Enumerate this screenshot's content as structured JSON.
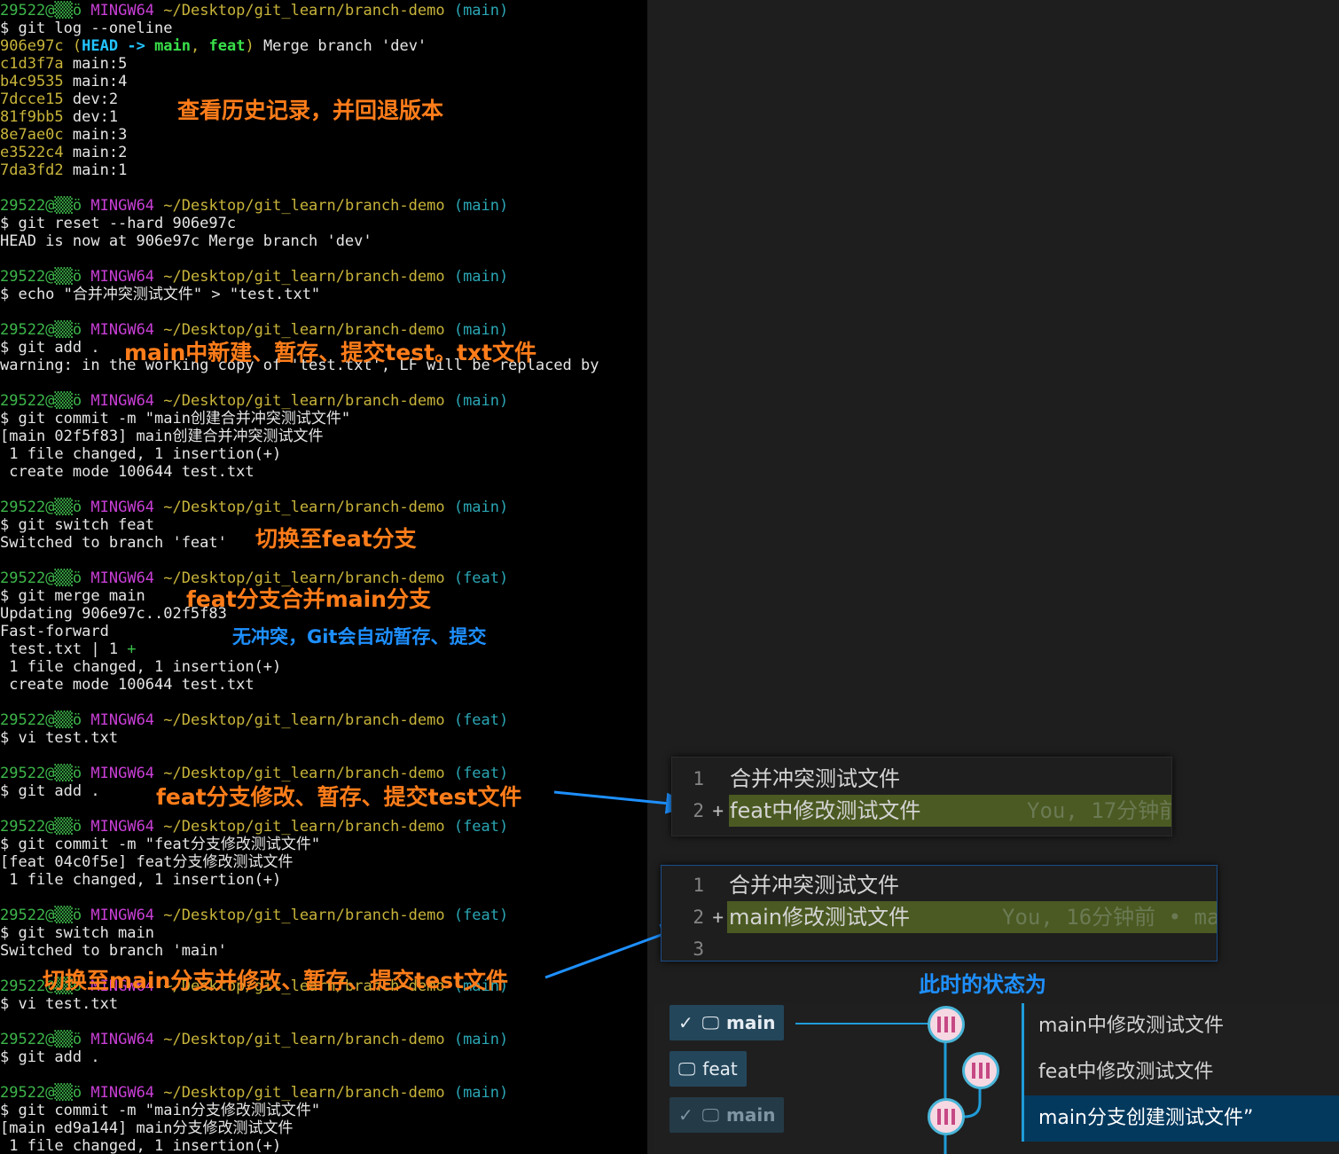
{
  "terminal": {
    "prompt": {
      "user": "29522@",
      "host_glyph": "▒▒ö",
      "env": "MINGW64",
      "path": "~/Desktop/git_learn/branch-demo",
      "branch_main": "(main)",
      "branch_feat": "(feat)"
    },
    "log": {
      "cmd": "$ git log --oneline",
      "head_hash": "906e97c",
      "head_open": "(",
      "head_label": "HEAD",
      "head_arrow": " -> ",
      "head_main": "main",
      "head_sep": ", ",
      "head_feat": "feat",
      "head_close": ")",
      "head_msg": " Merge branch 'dev'",
      "entries": [
        {
          "hash": "c1d3f7a",
          "msg": " main:5"
        },
        {
          "hash": "b4c9535",
          "msg": " main:4"
        },
        {
          "hash": "7dcce15",
          "msg": " dev:2"
        },
        {
          "hash": "81f9bb5",
          "msg": " dev:1"
        },
        {
          "hash": "8e7ae0c",
          "msg": " main:3"
        },
        {
          "hash": "e3522c4",
          "msg": " main:2"
        },
        {
          "hash": "7da3fd2",
          "msg": " main:1"
        }
      ]
    },
    "lines": {
      "reset_cmd": "$ git reset --hard 906e97c",
      "reset_out": "HEAD is now at 906e97c Merge branch 'dev'",
      "echo_cmd": "$ echo \"合并冲突测试文件\" > \"test.txt\"",
      "add_cmd": "$ git add .",
      "warning": "warning: in the working copy of 'test.txt', LF will be replaced by",
      "commit1_cmd": "$ git commit -m \"main创建合并冲突测试文件\"",
      "commit1_out": "[main 02f5f83] main创建合并冲突测试文件",
      "changed": " 1 file changed, 1 insertion(+)",
      "create_mode": " create mode 100644 test.txt",
      "switch_feat_cmd": "$ git switch feat",
      "switch_feat_out": "Switched to branch 'feat'",
      "merge_cmd": "$ git merge main",
      "merge_out": "Updating 906e97c..02f5f83",
      "ff": "Fast-forward",
      "stat": " test.txt | 1 ",
      "stat_plus": "+",
      "vi_cmd": "$ vi test.txt",
      "commit2_cmd": "$ git commit -m \"feat分支修改测试文件\"",
      "commit2_out": "[feat 04c0f5e] feat分支修改测试文件",
      "switch_main_cmd": "$ git switch main",
      "switch_main_out": "Switched to branch 'main'",
      "commit3_cmd": "$ git commit -m \"main分支修改测试文件\"",
      "commit3_out": "[main ed9a144] main分支修改测试文件"
    }
  },
  "annotations": {
    "history": "查看历史记录，并回退版本",
    "main_new": "main中新建、暂存、提交test。txt文件",
    "switch_feat": "切换至feat分支",
    "feat_merge": "feat分支合并main分支",
    "no_conflict": "无冲突，Git会自动暂存、提交",
    "feat_modify": "feat分支修改、暂存、提交test文件",
    "main_modify": "切换至main分支并修改、暂存、提交test文件",
    "state": "此时的状态为"
  },
  "editor_feat": {
    "lines": [
      {
        "num": "1",
        "text": "合并冲突测试文件"
      },
      {
        "num": "2",
        "marker": "+",
        "text": "feat中修改测试文件",
        "blame": "You, 17分钟前"
      }
    ]
  },
  "editor_main": {
    "lines": [
      {
        "num": "1",
        "text": "合并冲突测试文件"
      },
      {
        "num": "2",
        "marker": "+",
        "text": "main修改测试文件",
        "blame": "You, 16分钟前 • ma"
      },
      {
        "num": "3",
        "text": ""
      }
    ]
  },
  "graph": {
    "rows": [
      {
        "ref": "main",
        "checked": true,
        "message": "main中修改测试文件"
      },
      {
        "ref": "feat",
        "checked": false,
        "message": "feat中修改测试文件"
      },
      {
        "ref": "main",
        "checked": true,
        "message": "main分支创建测试文件”"
      }
    ]
  },
  "colors": {
    "terminal_bg": "#000000",
    "prompt_green": "#3db64a",
    "prompt_magenta": "#c93fd6",
    "path_yellow": "#c8b43a",
    "branch_cyan": "#2aa6b4",
    "annotation_orange": "#ff7d1a",
    "annotation_blue": "#1e90ff",
    "editor_highlight": "#4b5a22",
    "graph_selected": "#04395e"
  }
}
